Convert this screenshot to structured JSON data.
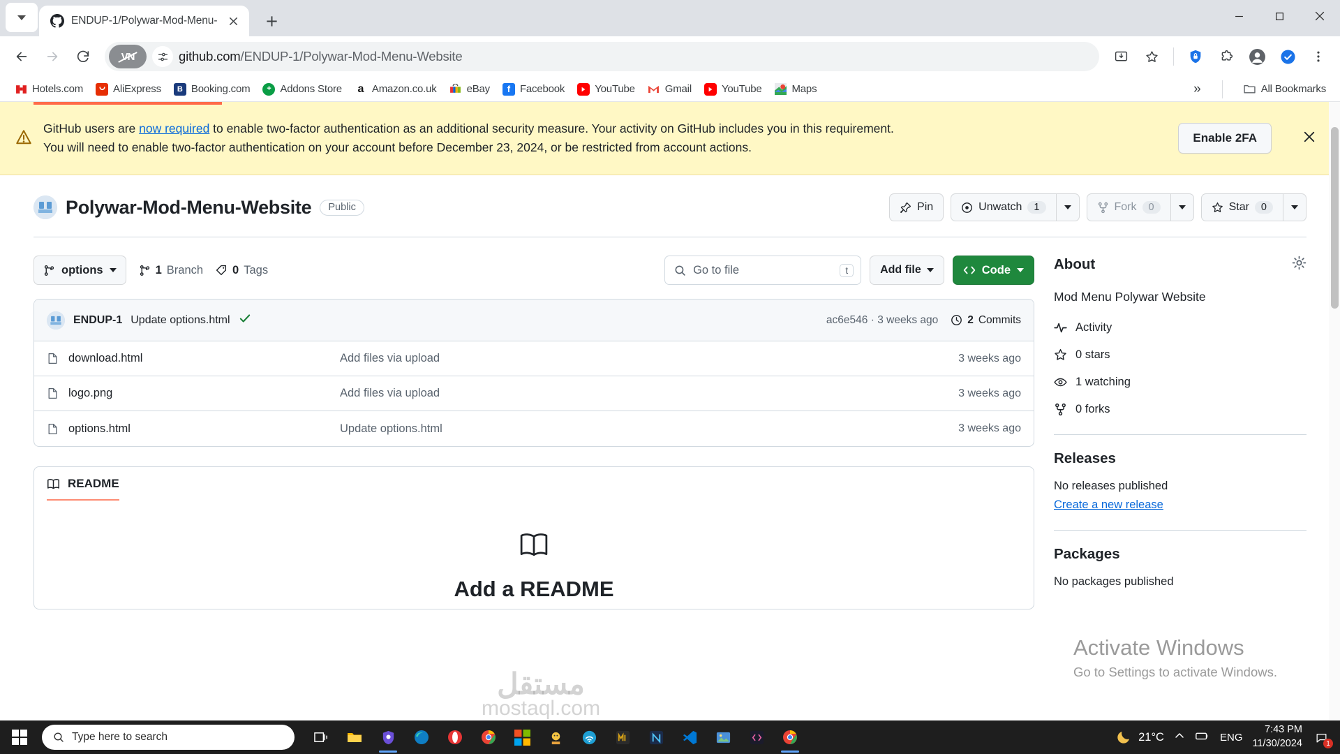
{
  "browser": {
    "tab": {
      "title": "ENDUP-1/Polywar-Mod-Menu-",
      "favicon": "github-icon"
    },
    "new_tab_label": "+",
    "omnibox": {
      "vpn_label": "VPN",
      "url_host": "github.com",
      "url_path": "/ENDUP-1/Polywar-Mod-Menu-Website"
    },
    "bookmarks": [
      {
        "label": "Hotels.com",
        "icon": "hotels-icon",
        "color": "#e02020"
      },
      {
        "label": "AliExpress",
        "icon": "aliexpress-icon",
        "color": "#e62e04"
      },
      {
        "label": "Booking.com",
        "icon": "booking-icon",
        "color": "#1a3b7c"
      },
      {
        "label": "Addons Store",
        "icon": "addons-icon",
        "color": "#0a9d45"
      },
      {
        "label": "Amazon.co.uk",
        "icon": "amazon-icon",
        "color": "#ff9900"
      },
      {
        "label": "eBay",
        "icon": "ebay-icon",
        "color": "#e53238"
      },
      {
        "label": "Facebook",
        "icon": "facebook-icon",
        "color": "#1877f2"
      },
      {
        "label": "YouTube",
        "icon": "youtube-icon",
        "color": "#ff0000"
      },
      {
        "label": "Gmail",
        "icon": "gmail-icon",
        "color": "#ea4335"
      },
      {
        "label": "YouTube",
        "icon": "youtube-icon",
        "color": "#ff0000"
      },
      {
        "label": "Maps",
        "icon": "maps-icon",
        "color": "#34a853"
      }
    ],
    "overflow_label": "»",
    "all_bookmarks_label": "All Bookmarks"
  },
  "banner": {
    "text_before": "GitHub users are ",
    "link_text": "now required",
    "text_after": " to enable two-factor authentication as an additional security measure. Your activity on GitHub includes you in this requirement. You will need to enable two-factor authentication on your account before December 23, 2024, or be restricted from account actions.",
    "button_label": "Enable 2FA",
    "close_label": "×"
  },
  "repo": {
    "name": "Polywar-Mod-Menu-Website",
    "visibility": "Public",
    "actions": {
      "pin": "Pin",
      "unwatch": "Unwatch",
      "unwatch_count": "1",
      "fork": "Fork",
      "fork_count": "0",
      "star": "Star",
      "star_count": "0"
    }
  },
  "file_toolbar": {
    "branch": "options",
    "branch_count": "1",
    "branch_label": "Branch",
    "tag_count": "0",
    "tag_label": "Tags",
    "search_placeholder": "Go to file",
    "search_kbd": "t",
    "add_file": "Add file",
    "code": "Code"
  },
  "commit": {
    "author": "ENDUP-1",
    "message": "Update options.html",
    "status_icon": "check-icon",
    "hash": "ac6e546",
    "separator": "·",
    "age": "3 weeks ago",
    "commits_count": "2",
    "commits_label": "Commits"
  },
  "files": [
    {
      "icon": "file-icon",
      "name": "download.html",
      "message": "Add files via upload",
      "age": "3 weeks ago"
    },
    {
      "icon": "file-icon",
      "name": "logo.png",
      "message": "Add files via upload",
      "age": "3 weeks ago"
    },
    {
      "icon": "file-icon",
      "name": "options.html",
      "message": "Update options.html",
      "age": "3 weeks ago"
    }
  ],
  "readme": {
    "tab_label": "README",
    "heading": "Add a README"
  },
  "about": {
    "title": "About",
    "description": "Mod Menu Polywar Website",
    "links": [
      {
        "label": "Activity",
        "icon": "pulse-icon"
      },
      {
        "label": "0 stars",
        "icon": "star-icon"
      },
      {
        "label": "1 watching",
        "icon": "eye-icon"
      },
      {
        "label": "0 forks",
        "icon": "fork-icon"
      }
    ],
    "releases_title": "Releases",
    "releases_empty": "No releases published",
    "releases_link": "Create a new release",
    "packages_title": "Packages",
    "packages_empty": "No packages published"
  },
  "watermarks": {
    "activate_line1": "Activate Windows",
    "activate_line2": "Go to Settings to activate Windows.",
    "mostaql_ar": "مستقل",
    "mostaql_en": "mostaql.com"
  },
  "taskbar": {
    "search_placeholder": "Type here to search",
    "temperature": "21°C",
    "language": "ENG",
    "time": "7:43 PM",
    "date": "11/30/2024",
    "notification_count": "1",
    "apps": [
      {
        "name": "task-view-icon"
      },
      {
        "name": "file-explorer-icon"
      },
      {
        "name": "shield-app-icon"
      },
      {
        "name": "edge-icon"
      },
      {
        "name": "opera-icon"
      },
      {
        "name": "chrome-icon"
      },
      {
        "name": "store-icon"
      },
      {
        "name": "character-icon"
      },
      {
        "name": "wifi-app-icon"
      },
      {
        "name": "m-app-icon"
      },
      {
        "name": "n-app-icon"
      },
      {
        "name": "vscode-icon"
      },
      {
        "name": "photos-icon"
      },
      {
        "name": "code-editor-icon"
      },
      {
        "name": "chrome-active-icon"
      }
    ]
  }
}
